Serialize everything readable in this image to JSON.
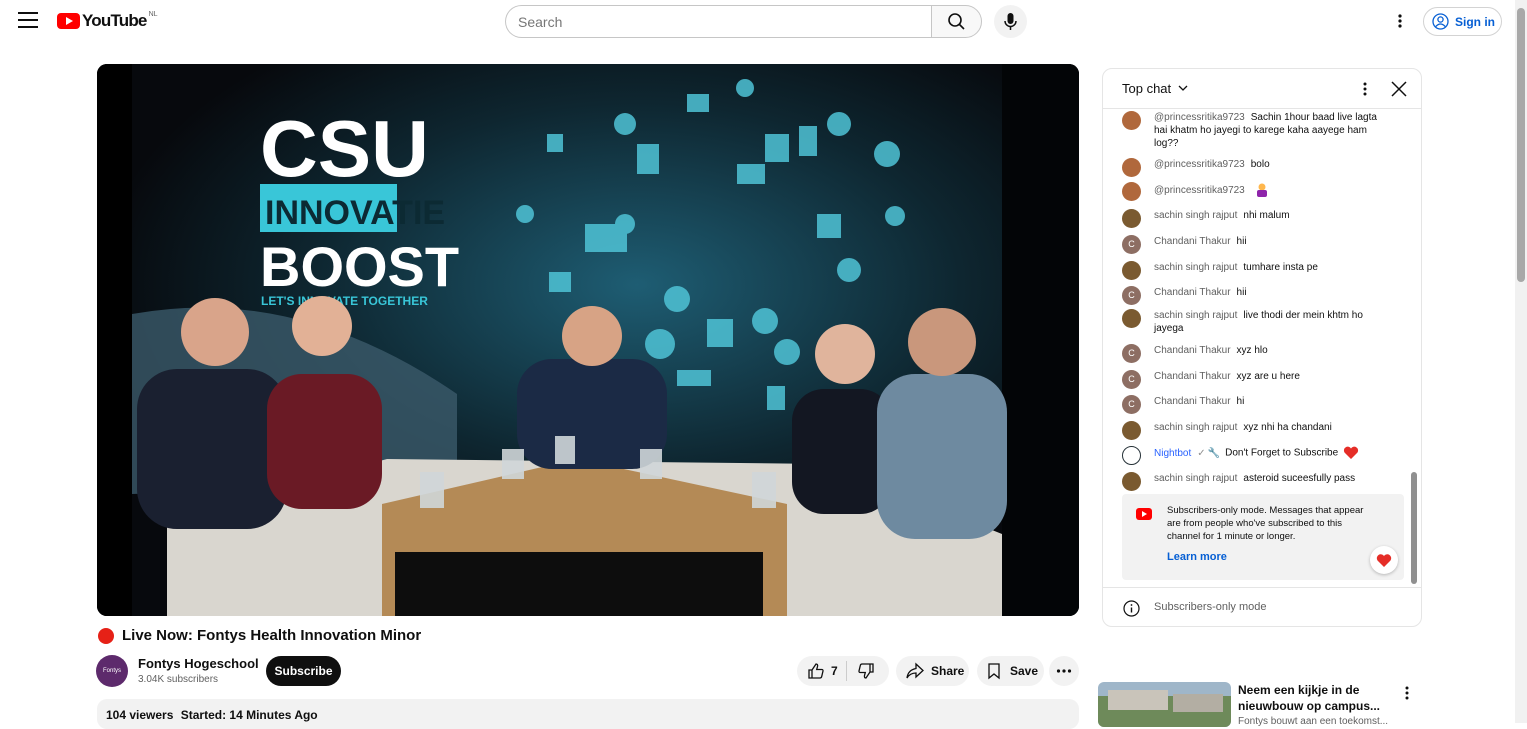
{
  "header": {
    "logo_text": "YouTube",
    "country_code": "NL",
    "search_placeholder": "Search",
    "signin_label": "Sign in"
  },
  "video": {
    "overlay_title_1": "CSU",
    "overlay_title_2": "INNOVATIE",
    "overlay_title_3": "BOOST",
    "overlay_tagline": "LET'S INNOVATE TOGETHER",
    "title": "Live Now: Fontys Health Innovation Minor"
  },
  "channel": {
    "avatar_text": "Fontys",
    "name": "Fontys Hogeschool",
    "subscribers": "3.04K subscribers",
    "subscribe_label": "Subscribe"
  },
  "actions": {
    "like_count": "7",
    "share_label": "Share",
    "save_label": "Save"
  },
  "description": {
    "viewers": "104 viewers",
    "started": "Started: 14 Minutes Ago"
  },
  "chat": {
    "mode_label": "Top chat",
    "messages": [
      {
        "author": "@princessritika9723",
        "text": "Sachin 1hour baad live lagta hai khatm ho jayegi to karege kaha aayege ham log??",
        "avatar_color": "#b0683c"
      },
      {
        "author": "@princessritika9723",
        "text": "bolo",
        "avatar_color": "#b0683c"
      },
      {
        "author": "@princessritika9723",
        "text": "",
        "avatar_color": "#b0683c"
      },
      {
        "author": "sachin singh rajput",
        "text": "nhi malum",
        "avatar_color": "#7a5a30"
      },
      {
        "author": "Chandani Thakur",
        "text": "hii",
        "avatar_color": "#8d6e63"
      },
      {
        "author": "sachin singh rajput",
        "text": "tumhare insta pe",
        "avatar_color": "#7a5a30"
      },
      {
        "author": "Chandani Thakur",
        "text": "hii",
        "avatar_color": "#8d6e63"
      },
      {
        "author": "sachin singh rajput",
        "text": "live thodi der mein khtm ho jayega",
        "avatar_color": "#7a5a30"
      },
      {
        "author": "Chandani Thakur",
        "text": "xyz hlo",
        "avatar_color": "#8d6e63"
      },
      {
        "author": "Chandani Thakur",
        "text": "xyz are u here",
        "avatar_color": "#8d6e63"
      },
      {
        "author": "Chandani Thakur",
        "text": "hi",
        "avatar_color": "#8d6e63"
      },
      {
        "author": "sachin singh rajput",
        "text": "xyz nhi ha chandani",
        "avatar_color": "#7a5a30"
      },
      {
        "author": "Nightbot",
        "text": "Don't Forget to Subscribe",
        "avatar_color": "#ffffff",
        "author_color": "#2962ff"
      },
      {
        "author": "sachin singh rajput",
        "text": "asteroid suceesfully pass",
        "avatar_color": "#7a5a30"
      }
    ],
    "avatar_letter": "C",
    "notice_text": "Subscribers-only mode. Messages that appear are from people who've subscribed to this channel for 1 minute or longer.",
    "learn_more": "Learn more",
    "footer_text": "Subscribers-only mode"
  },
  "recommendation": {
    "title": "Neem een kijkje in de nieuwbouw op campus...",
    "subtitle": "Fontys bouwt aan een toekomst..."
  },
  "colors": {
    "brand_red": "#ff0000",
    "link_blue": "#065fd4",
    "live_red": "#e62117",
    "heart": "#e52d27"
  }
}
